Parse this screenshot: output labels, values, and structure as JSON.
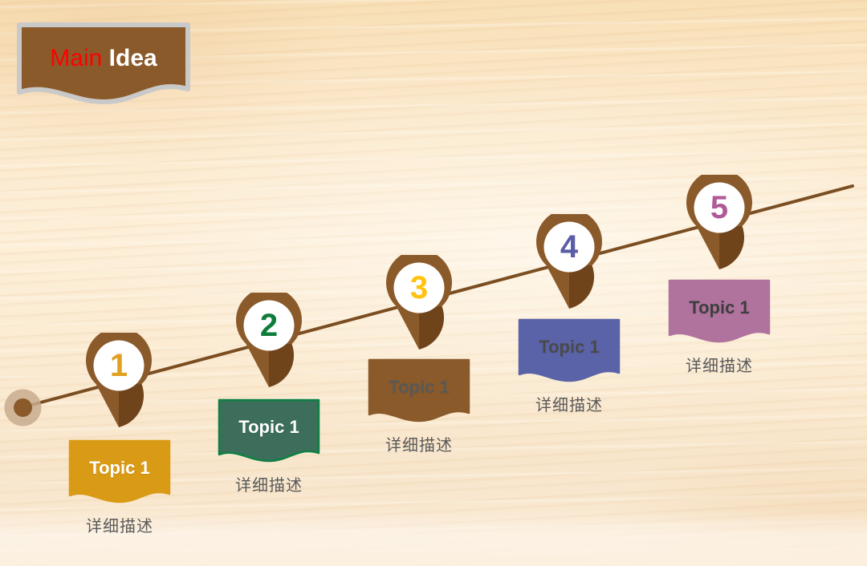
{
  "slide": {
    "background_color": "#FBE8CA",
    "accent_brown": "#7B4E22",
    "line_color": "#7B4E22"
  },
  "banner": {
    "title_part1": "Main",
    "title_part2": " Idea",
    "fill_color": "#8B5A2B",
    "border_color": "#C9C9C9",
    "part1_color": "#FF0000",
    "part2_color": "#FFFFFF"
  },
  "timeline": {
    "start_dot": {
      "core_color": "#8B5A2B",
      "ring_color": "#C8AC8E"
    },
    "steps": [
      {
        "number": "1",
        "number_color": "#E0A020",
        "topic": "Topic 1",
        "topic_color": "#FFFFFF",
        "description": "详细描述",
        "card_color": "#D99A16",
        "card_border": "#D99A16",
        "pin_color": "#8B5A2B"
      },
      {
        "number": "2",
        "number_color": "#0E7C3A",
        "topic": "Topic 1",
        "topic_color": "#FFFFFF",
        "description": "详细描述",
        "card_color": "#3C6E5B",
        "card_border": "#0E8043",
        "pin_color": "#8B5A2B"
      },
      {
        "number": "3",
        "number_color": "#FFC20E",
        "topic": "Topic 1",
        "topic_color": "#595959",
        "description": "详细描述",
        "card_color": "#8B5A2B",
        "card_border": "#8B5A2B",
        "pin_color": "#8B5A2B"
      },
      {
        "number": "4",
        "number_color": "#5B5EA6",
        "topic": "Topic 1",
        "topic_color": "#4A4A4A",
        "description": "详细描述",
        "card_color": "#5B63A8",
        "card_border": "#5B63A8",
        "pin_color": "#8B5A2B"
      },
      {
        "number": "5",
        "number_color": "#B05A97",
        "topic": "Topic 1",
        "topic_color": "#3F3F3F",
        "description": "详细描述",
        "card_color": "#B0739E",
        "card_border": "#B0739E",
        "pin_color": "#8B5A2B"
      }
    ]
  }
}
